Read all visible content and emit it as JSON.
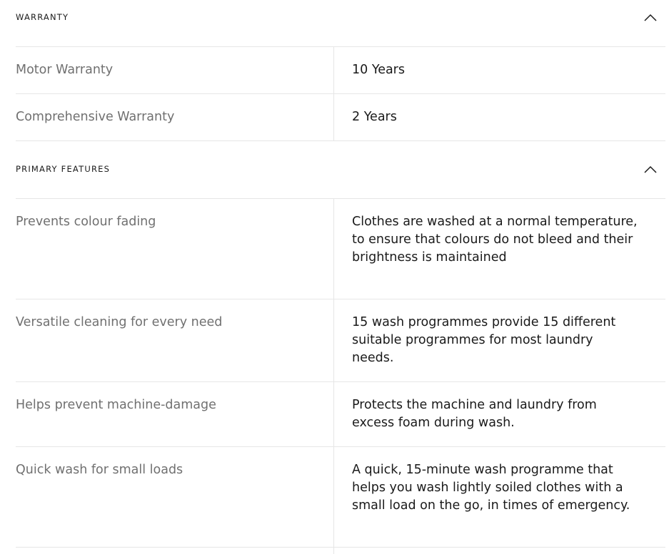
{
  "warranty": {
    "title": "WARRANTY",
    "toggle_icon": "chevron-up-icon",
    "rows": [
      {
        "label": "Motor Warranty",
        "value": "10 Years"
      },
      {
        "label": "Comprehensive Warranty",
        "value": "2 Years"
      }
    ]
  },
  "features": {
    "title": "PRIMARY FEATURES",
    "toggle_icon": "chevron-up-icon",
    "rows": [
      {
        "label": "Prevents colour fading",
        "value": "Clothes are washed at a normal temperature, to ensure that colours do not bleed and their brightness is maintained"
      },
      {
        "label": "Versatile cleaning for every need",
        "value": "15 wash programmes provide 15 different suitable programmes for most laundry needs."
      },
      {
        "label": "Helps prevent machine-damage",
        "value": "Protects the machine and laundry from excess foam during wash."
      },
      {
        "label": "Quick wash for small loads",
        "value": "A quick, 15-minute wash programme that helps you wash lightly soiled clothes with a small load on the go, in times of emergency."
      }
    ]
  }
}
